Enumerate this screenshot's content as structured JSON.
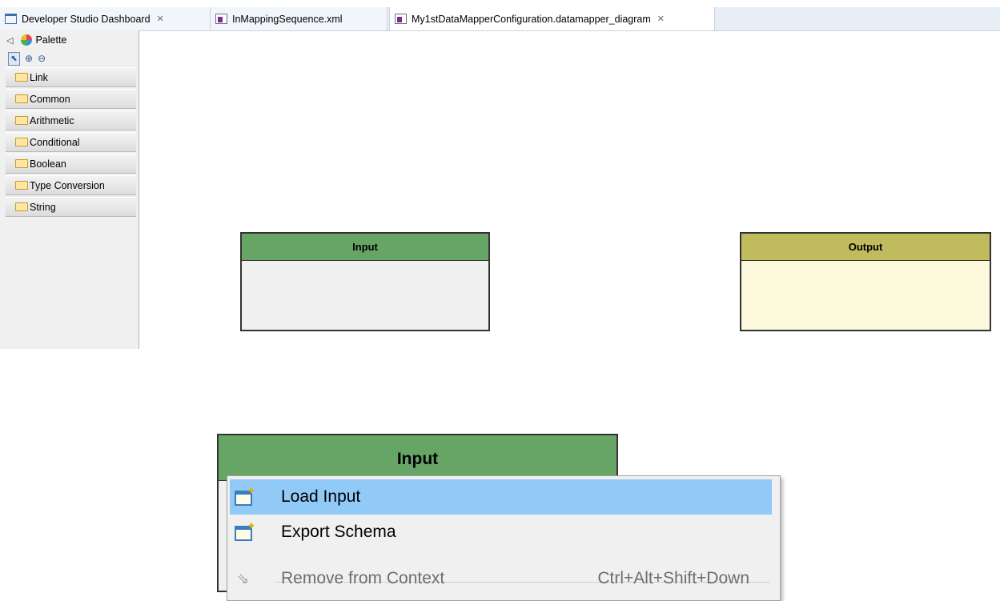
{
  "tabs": [
    {
      "label": "Developer Studio Dashboard",
      "close": "✕",
      "icon": "dashboard-icon"
    },
    {
      "label": "InMappingSequence.xml",
      "close": "",
      "icon": "xml-file-icon"
    },
    {
      "label": "My1stDataMapperConfiguration.datamapper_diagram",
      "close": "✕",
      "icon": "diagram-file-icon"
    }
  ],
  "palette": {
    "title": "Palette",
    "drawers": [
      "Link",
      "Common",
      "Arithmetic",
      "Conditional",
      "Boolean",
      "Type Conversion",
      "String"
    ]
  },
  "diagram": {
    "input_title": "Input",
    "output_title": "Output"
  },
  "zoom": {
    "input_title": "Input"
  },
  "context_menu": {
    "items": [
      {
        "label": "Load Input",
        "shortcut": "",
        "highlighted": true,
        "enabled": true,
        "icon": "load-input-icon"
      },
      {
        "label": "Export Schema",
        "shortcut": "",
        "highlighted": false,
        "enabled": true,
        "icon": "export-schema-icon"
      },
      {
        "label": "Remove from Context",
        "shortcut": "Ctrl+Alt+Shift+Down",
        "highlighted": false,
        "enabled": false,
        "icon": "remove-context-icon"
      }
    ]
  },
  "colors": {
    "input_header": "#66a566",
    "output_header": "#c0bb5d",
    "menu_highlight": "#91c9f7"
  }
}
